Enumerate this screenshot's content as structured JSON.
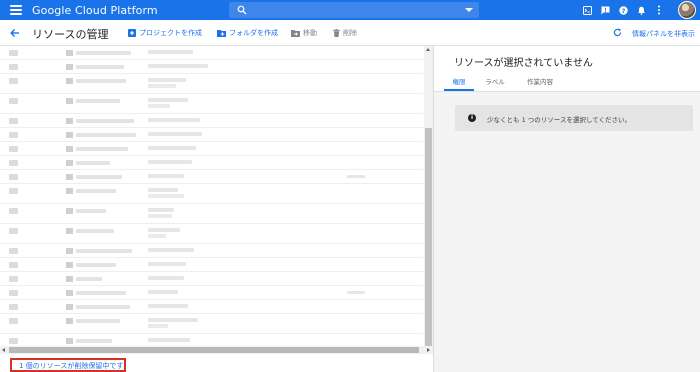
{
  "topbar": {
    "app_title": "Google Cloud Platform",
    "icons": [
      "menu-icon",
      "search-icon",
      "dropdown-icon",
      "cloud-shell-icon",
      "feedback-icon",
      "help-icon",
      "notifications-icon",
      "more-icon",
      "account-avatar"
    ]
  },
  "header": {
    "title": "リソースの管理",
    "create_project": "プロジェクトを作成",
    "create_folder": "フォルダを作成",
    "move": "移動",
    "delete": "削除",
    "toggle_info_panel": "情報パネルを非表示"
  },
  "list": {
    "pending_deletion_link": "1 個のリソースが削除保留中です"
  },
  "info_panel": {
    "title": "リソースが選択されていません",
    "tabs": [
      "権限",
      "ラベル",
      "作業内容"
    ],
    "message": "少なくとも 1 つのリソースを選択してください。"
  },
  "colors": {
    "brand": "#1a73e8",
    "highlight_border": "#d93025"
  }
}
